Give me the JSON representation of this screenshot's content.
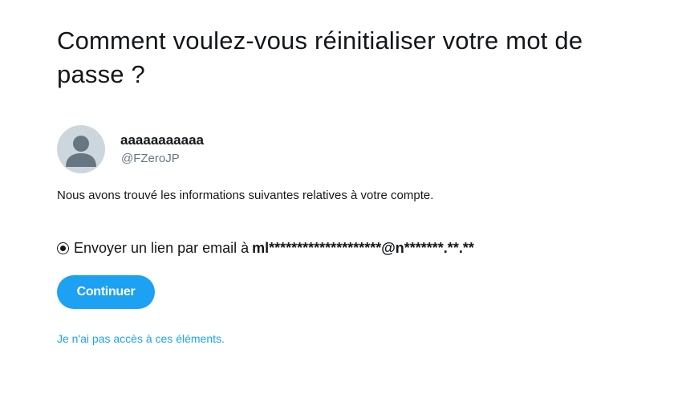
{
  "header": {
    "title": "Comment voulez-vous réinitialiser votre mot de passe ?"
  },
  "account": {
    "name": "aaaaaaaaaaa",
    "handle": "@FZeroJP",
    "avatar_icon": "default-profile-icon"
  },
  "info_text": "Nous avons trouvé les informations suivantes relatives à votre compte.",
  "reset_option": {
    "selected": true,
    "label": "Envoyer un lien par email à",
    "masked_email": "ml********************@n*******.**.**"
  },
  "continue_button": {
    "label": "Continuer"
  },
  "no_access_link": {
    "label": "Je n'ai pas accès à ces éléments."
  },
  "colors": {
    "accent": "#1da1f2",
    "text": "#14171a",
    "muted": "#657786",
    "avatar_bg": "#ccd6dd",
    "avatar_fg": "#687681"
  }
}
